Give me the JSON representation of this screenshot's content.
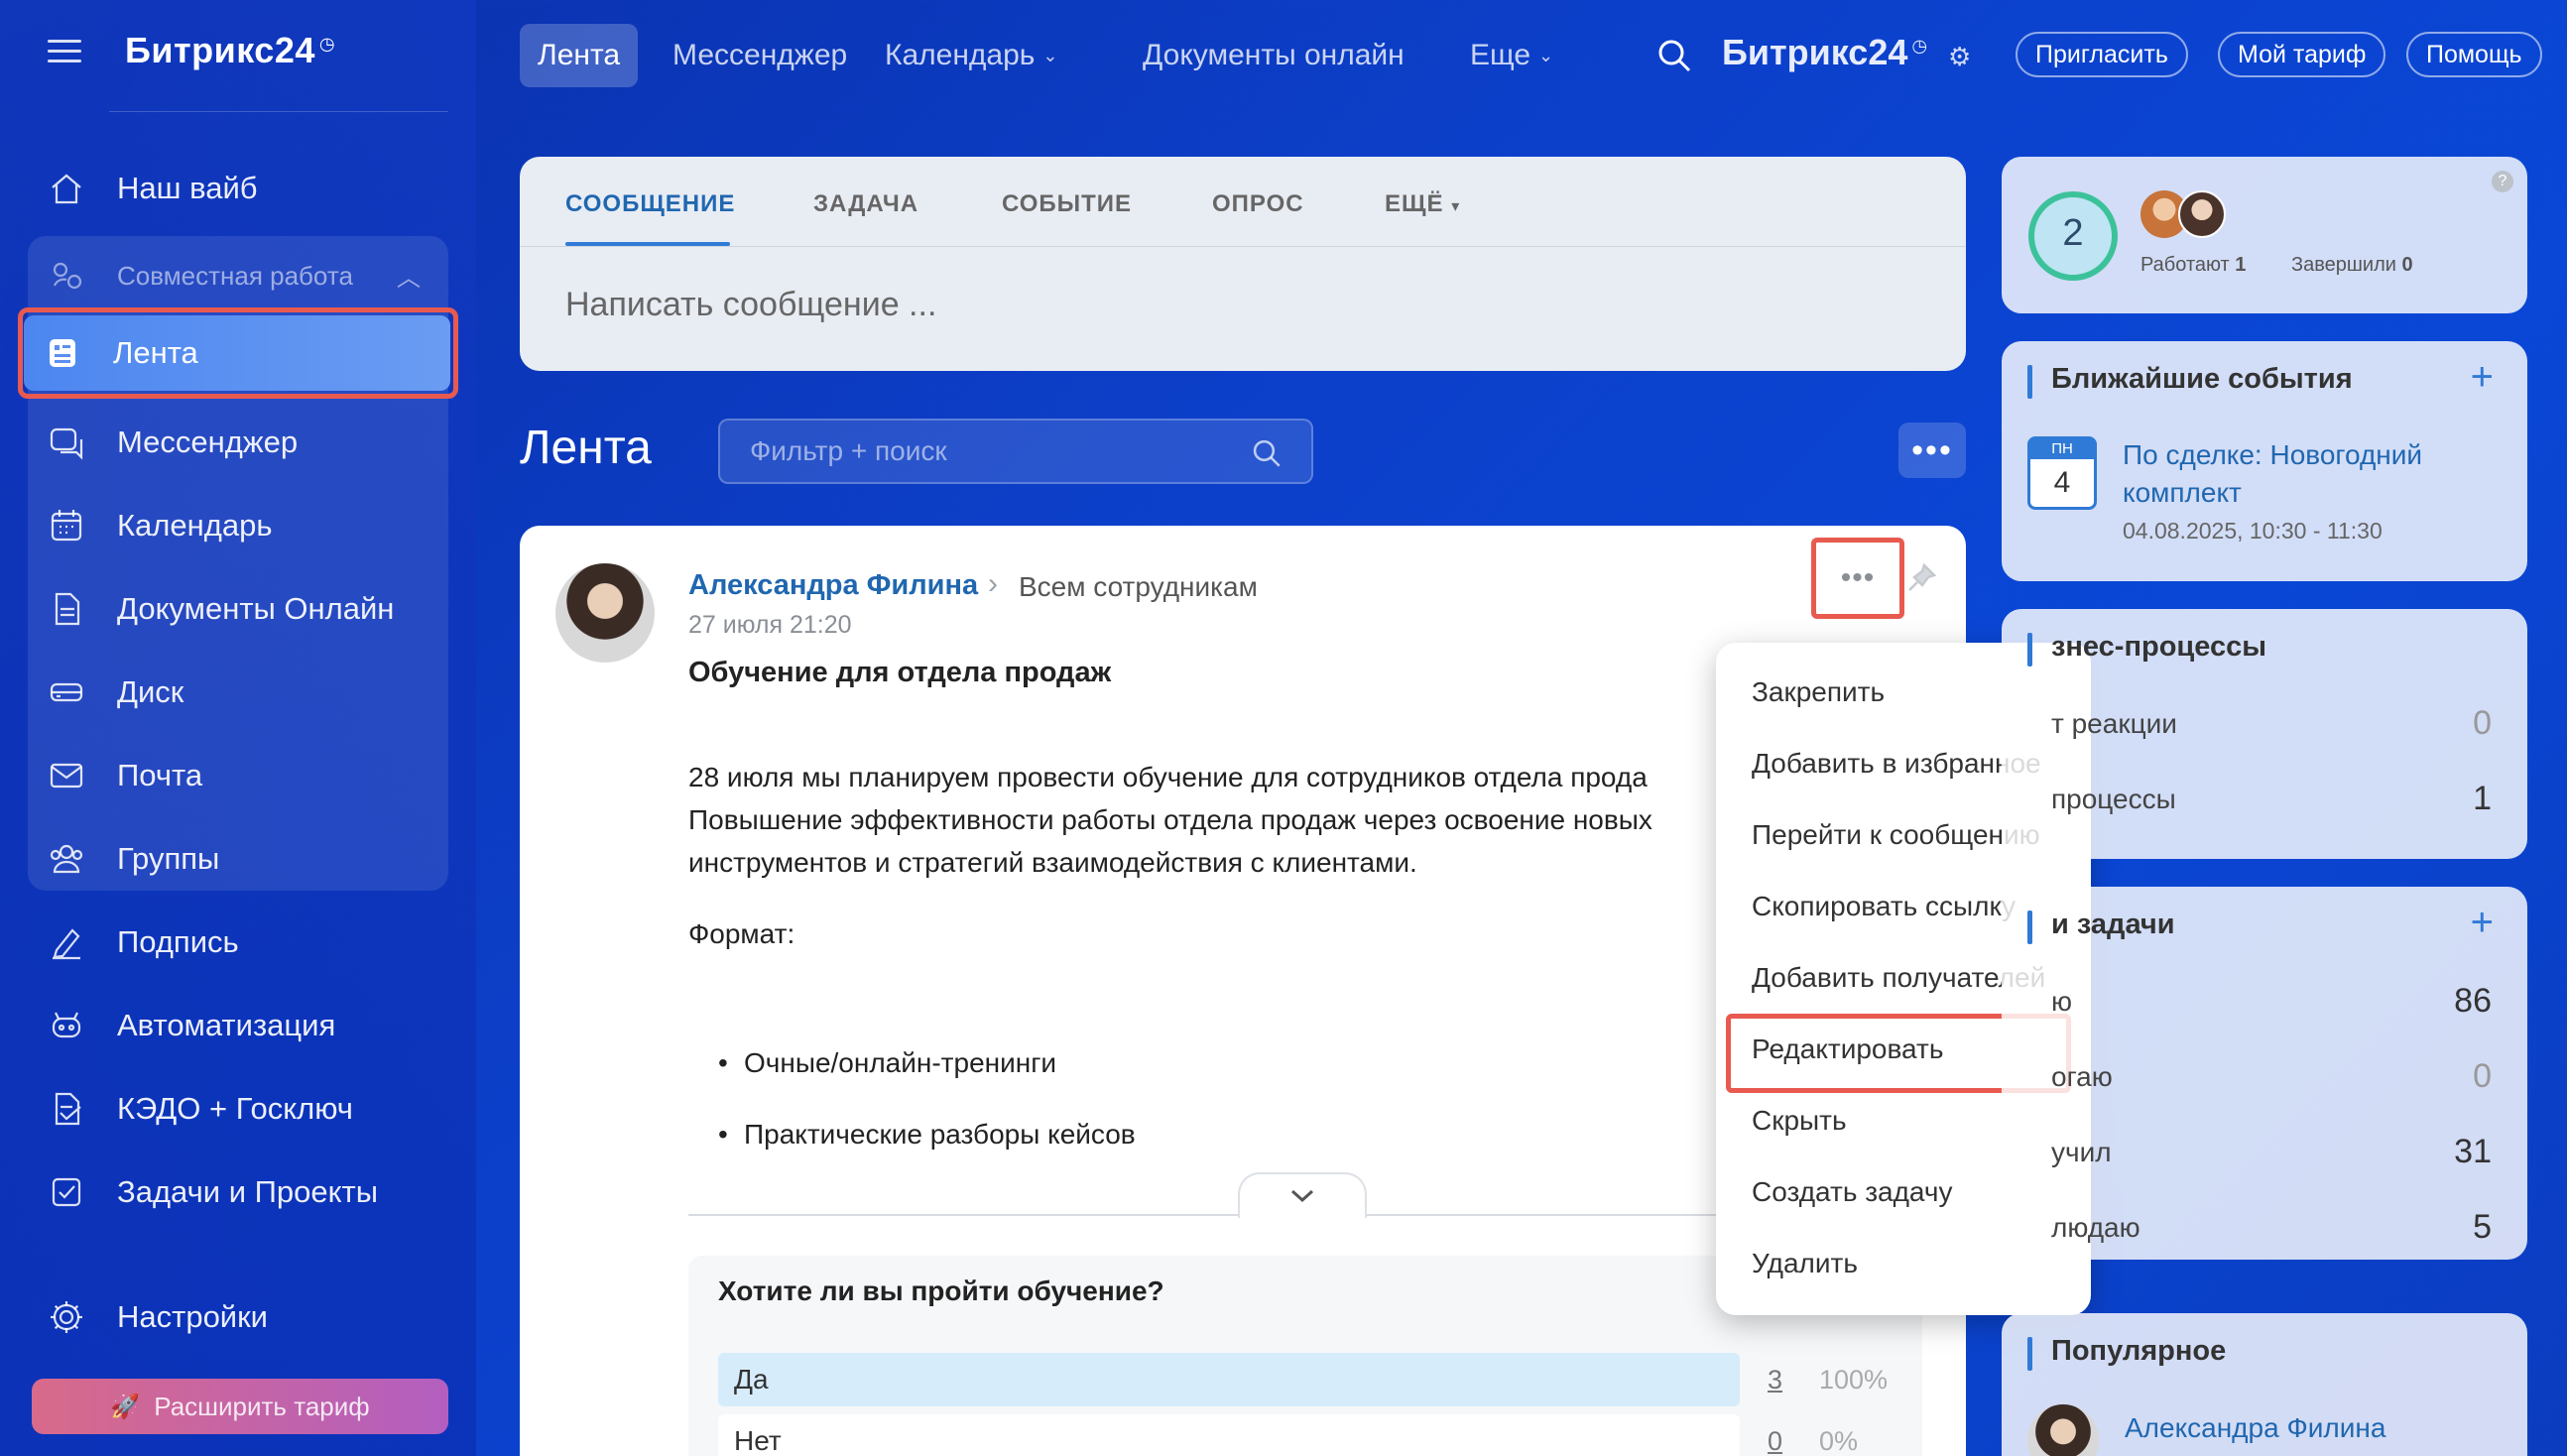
{
  "sidebar": {
    "brand": "Битрикс24",
    "items": {
      "vibe": "Наш вайб",
      "group": "Совместная работа",
      "feed": "Лента",
      "messenger": "Мессенджер",
      "calendar": "Календарь",
      "docs": "Документы Онлайн",
      "disk": "Диск",
      "mail": "Почта",
      "groups": "Группы",
      "sign": "Подпись",
      "automation": "Автоматизация",
      "kedo": "КЭДО + Госключ",
      "tasks": "Задачи и Проекты",
      "settings": "Настройки"
    },
    "upgrade": "Расширить тариф"
  },
  "topbar": {
    "tabs": {
      "feed": "Лента",
      "messenger": "Мессенджер",
      "calendar": "Календарь",
      "docs": "Документы онлайн",
      "more": "Еще"
    },
    "brand": "Битрикс24",
    "invite": "Пригласить",
    "tariff": "Мой тариф",
    "help": "Помощь"
  },
  "composer": {
    "tabs": {
      "message": "СООБЩЕНИЕ",
      "task": "ЗАДАЧА",
      "event": "СОБЫТИЕ",
      "poll": "ОПРОС",
      "more": "ЕЩЁ"
    },
    "placeholder": "Написать сообщение ..."
  },
  "feed": {
    "title": "Лента",
    "search_placeholder": "Фильтр + поиск"
  },
  "post": {
    "author": "Александра Филина",
    "recipients": "Всем сотрудникам",
    "date": "27 июля 21:20",
    "title": "Обучение для отдела продаж",
    "lines": {
      "l1": "28 июля мы планируем провести обучение для сотрудников отдела прода",
      "l2": "Повышение эффективности работы отдела продаж через освоение новых",
      "l3": "инструментов и стратегий взаимодействия с клиентами.",
      "format": "Формат:"
    },
    "bullets": {
      "b1": "Очные/онлайн-тренинги",
      "b2": "Практические разборы кейсов"
    },
    "poll": {
      "question": "Хотите ли вы пройти обучение?",
      "yes_label": "Да",
      "yes_count": "3",
      "yes_pct": "100%",
      "no_label": "Нет",
      "no_count": "0",
      "no_pct": "0%"
    }
  },
  "menu": {
    "pin": "Закрепить",
    "fav": "Добавить в избранное",
    "goto": "Перейти к сообщению",
    "copy": "Скопировать ссылку",
    "add_recipients": "Добавить получателей",
    "edit": "Редактировать",
    "hide": "Скрыть",
    "create_task": "Создать задачу",
    "delete": "Удалить"
  },
  "right": {
    "workday": {
      "count": "2",
      "working_label": "Работают",
      "working_value": "1",
      "done_label": "Завершили",
      "done_value": "0"
    },
    "events": {
      "title": "Ближайшие события",
      "day_abbr": "ПН",
      "day_num": "4",
      "event_line1": "По сделке: Новогодний",
      "event_line2": "комплект",
      "event_time": "04.08.2025, 10:30 - 11:30"
    },
    "bp": {
      "title": "знес-процессы",
      "row1": "т реакции",
      "row1_value": "0",
      "row2": "процессы",
      "row2_value": "1"
    },
    "tasks": {
      "title": "и задачи",
      "row1": "ю",
      "row1_value": "86",
      "row2": "огаю",
      "row2_value": "0",
      "row3": "учил",
      "row3_value": "31",
      "row4": "людаю",
      "row4_value": "5"
    },
    "popular": {
      "title": "Популярное",
      "author": "Александра Филина"
    }
  }
}
